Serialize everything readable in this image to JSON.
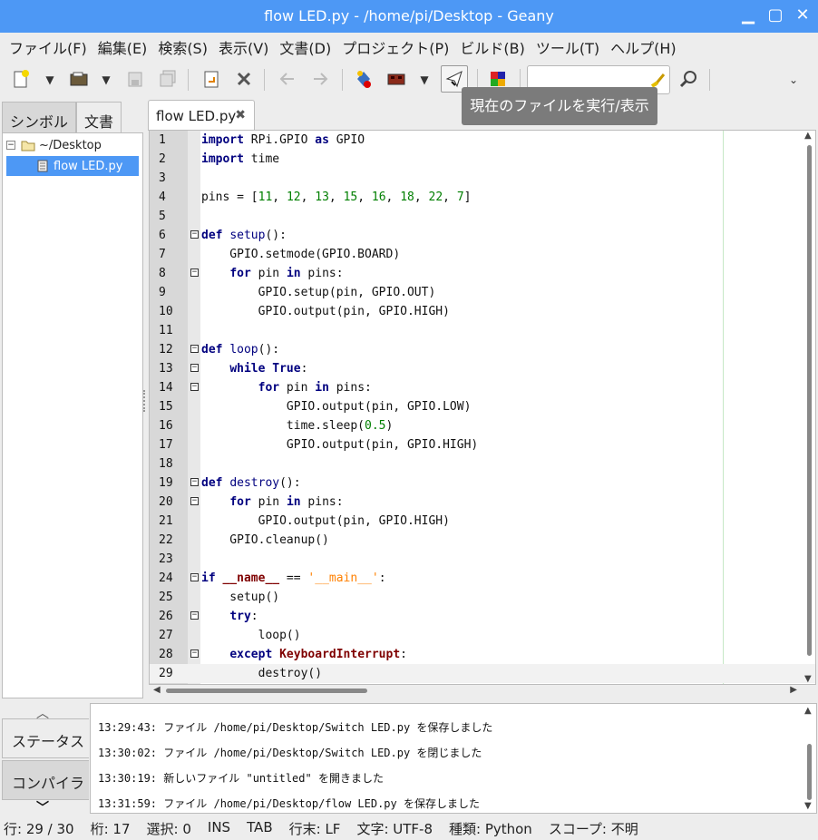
{
  "window": {
    "title": "flow LED.py - /home/pi/Desktop - Geany"
  },
  "menu": [
    "ファイル(F)",
    "編集(E)",
    "検索(S)",
    "表示(V)",
    "文書(D)",
    "プロジェクト(P)",
    "ビルド(B)",
    "ツール(T)",
    "ヘルプ(H)"
  ],
  "toolbar": {
    "tooltip": "現在のファイルを実行/表示",
    "search_value": ""
  },
  "sidebar": {
    "tabs": [
      "シンボル",
      "文書"
    ],
    "folder": "~/Desktop",
    "file": "flow LED.py"
  },
  "editor": {
    "tab_label": "flow LED.py",
    "lines": [
      {
        "n": "1",
        "t": "import RPi.GPIO as GPIO"
      },
      {
        "n": "2",
        "t": "import time"
      },
      {
        "n": "3",
        "t": ""
      },
      {
        "n": "4",
        "t": "pins = [11, 12, 13, 15, 16, 18, 22, 7]"
      },
      {
        "n": "5",
        "t": ""
      },
      {
        "n": "6",
        "t": "def setup():"
      },
      {
        "n": "7",
        "t": "    GPIO.setmode(GPIO.BOARD)"
      },
      {
        "n": "8",
        "t": "    for pin in pins:"
      },
      {
        "n": "9",
        "t": "        GPIO.setup(pin, GPIO.OUT)"
      },
      {
        "n": "10",
        "t": "        GPIO.output(pin, GPIO.HIGH)"
      },
      {
        "n": "11",
        "t": ""
      },
      {
        "n": "12",
        "t": "def loop():"
      },
      {
        "n": "13",
        "t": "    while True:"
      },
      {
        "n": "14",
        "t": "        for pin in pins:"
      },
      {
        "n": "15",
        "t": "            GPIO.output(pin, GPIO.LOW)"
      },
      {
        "n": "16",
        "t": "            time.sleep(0.5)"
      },
      {
        "n": "17",
        "t": "            GPIO.output(pin, GPIO.HIGH)"
      },
      {
        "n": "18",
        "t": ""
      },
      {
        "n": "19",
        "t": "def destroy():"
      },
      {
        "n": "20",
        "t": "    for pin in pins:"
      },
      {
        "n": "21",
        "t": "        GPIO.output(pin, GPIO.HIGH)"
      },
      {
        "n": "22",
        "t": "    GPIO.cleanup()"
      },
      {
        "n": "23",
        "t": ""
      },
      {
        "n": "24",
        "t": "if __name__ == '__main__':"
      },
      {
        "n": "25",
        "t": "    setup()"
      },
      {
        "n": "26",
        "t": "    try:"
      },
      {
        "n": "27",
        "t": "        loop()"
      },
      {
        "n": "28",
        "t": "    except KeyboardInterrupt:"
      },
      {
        "n": "29",
        "t": "        destroy()"
      }
    ],
    "fold_lines": [
      "6",
      "8",
      "12",
      "13",
      "14",
      "19",
      "20",
      "24",
      "26",
      "28"
    ],
    "current_line": "29"
  },
  "messages": {
    "tabs": [
      "ステータス",
      "コンパイラ"
    ],
    "lines": [
      "13:29:43: ファイル /home/pi/Desktop/Switch LED.py を保存しました",
      "13:30:02: ファイル /home/pi/Desktop/Switch LED.py を閉じました",
      "13:30:19: 新しいファイル \"untitled\" を開きました",
      "13:31:59: ファイル /home/pi/Desktop/flow LED.py を保存しました"
    ]
  },
  "status": {
    "line": "行: 29 / 30",
    "col": "桁: 17",
    "sel": "選択: 0",
    "ins": "INS",
    "tab": "TAB",
    "eol": "行末: LF",
    "enc": "文字: UTF-8",
    "type": "種類: Python",
    "scope": "スコープ: 不明"
  },
  "colors": {
    "titlebar": "#4d98f5",
    "selection": "#4d98f5",
    "keyword": "#00007f",
    "number": "#007f00",
    "string": "#ff8000"
  }
}
